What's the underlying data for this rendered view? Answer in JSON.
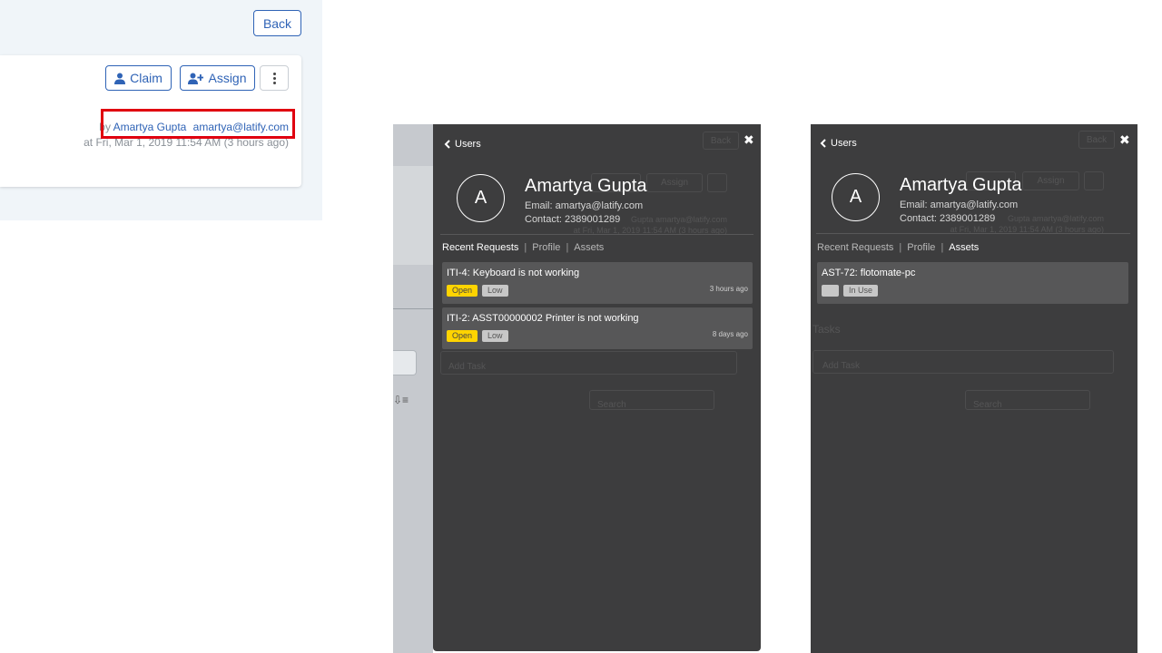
{
  "ticket": {
    "back_label": "Back",
    "claim_label": "Claim",
    "assign_label": "Assign",
    "by_prefix": "by",
    "author_name": "Amartya Gupta",
    "author_email": "amartya@latify.com",
    "created_at": "at Fri, Mar 1, 2019 11:54 AM (3 hours ago)"
  },
  "user_panel": {
    "back_label": "Users",
    "avatar_letter": "A",
    "name": "Amartya Gupta",
    "email_line": "Email: amartya@latify.com",
    "contact_line": "Contact: 2389001289",
    "tabs": [
      "Recent Requests",
      "Profile",
      "Assets"
    ]
  },
  "background_ghost": {
    "back": "Back",
    "assign": "Assign",
    "by_line": "Gupta  amartya@latify.com",
    "at_line": "at Fri, Mar 1, 2019 11:54 AM (3 hours ago)",
    "tasks_heading": "Tasks",
    "add_task": "Add Task",
    "search": "Search"
  },
  "recent_requests": [
    {
      "title": "ITI-4: Keyboard is not working",
      "status": "Open",
      "priority": "Low",
      "time": "3 hours ago"
    },
    {
      "title": "ITI-2: ASST00000002 Printer is not working",
      "status": "Open",
      "priority": "Low",
      "time": "8 days ago"
    }
  ],
  "assets": [
    {
      "title": "AST-72: flotomate-pc",
      "type": "",
      "status": "In Use"
    }
  ],
  "colors": {
    "accent": "#2f63b6",
    "highlight": "#e0000f",
    "panel_bg": "#3d3d3e",
    "open_badge": "#ffd400"
  }
}
